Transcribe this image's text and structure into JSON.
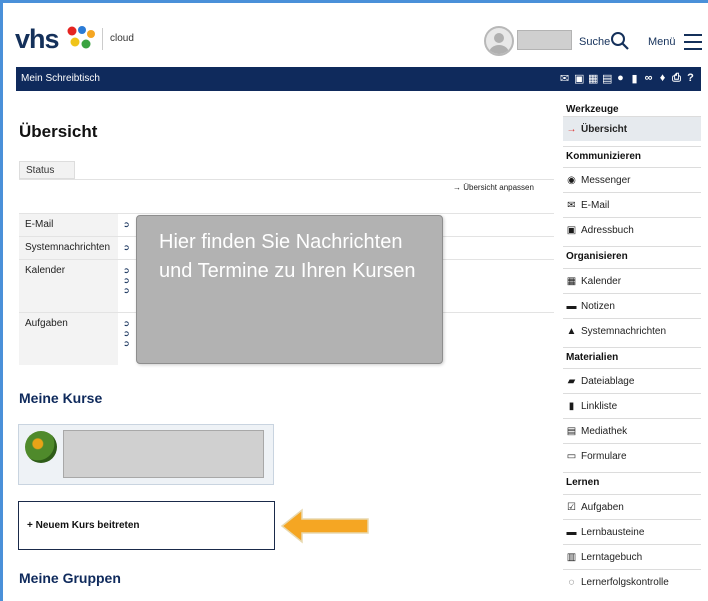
{
  "header": {
    "logo": "vhs",
    "cloud_label": "cloud",
    "search_label": "Suche",
    "menu_label": "Menü"
  },
  "navbar": {
    "title": "Mein Schreibtisch",
    "icons": [
      "mail-icon",
      "messenger-icon",
      "calendar-icon",
      "notes-icon",
      "user-icon",
      "bookmark-icon",
      "link-icon",
      "location-icon",
      "print-icon",
      "help-icon"
    ]
  },
  "main": {
    "title": "Übersicht",
    "tab_status": "Status",
    "customize_link": "Übersicht anpassen",
    "rows": [
      {
        "label": "E-Mail"
      },
      {
        "label": "Systemnachrichten"
      },
      {
        "label": "Kalender"
      },
      {
        "label": "Aufgaben"
      }
    ],
    "tooltip": "Hier finden Sie Nachrichten und Termine zu Ihren Kursen",
    "my_courses_title": "Meine Kurse",
    "join_course": "+ Neuem Kurs beitreten",
    "my_groups_title": "Meine Gruppen"
  },
  "sidebar": {
    "tools_head": "Werkzeuge",
    "overview": "Übersicht",
    "communicate_head": "Kommunizieren",
    "messenger": "Messenger",
    "email": "E-Mail",
    "addressbook": "Adressbuch",
    "organize_head": "Organisieren",
    "calendar": "Kalender",
    "notes": "Notizen",
    "system_messages": "Systemnachrichten",
    "materials_head": "Materialien",
    "file_storage": "Dateiablage",
    "link_list": "Linkliste",
    "media_library": "Mediathek",
    "forms": "Formulare",
    "learn_head": "Lernen",
    "tasks": "Aufgaben",
    "learning_modules": "Lernbausteine",
    "learning_diary": "Lerntagebuch",
    "progress_check": "Lernerfolgskontrolle"
  },
  "colors": {
    "navy": "#0f2a5c",
    "arrow": "#f5a623",
    "tooltip_bg": "#b2b2b2"
  }
}
